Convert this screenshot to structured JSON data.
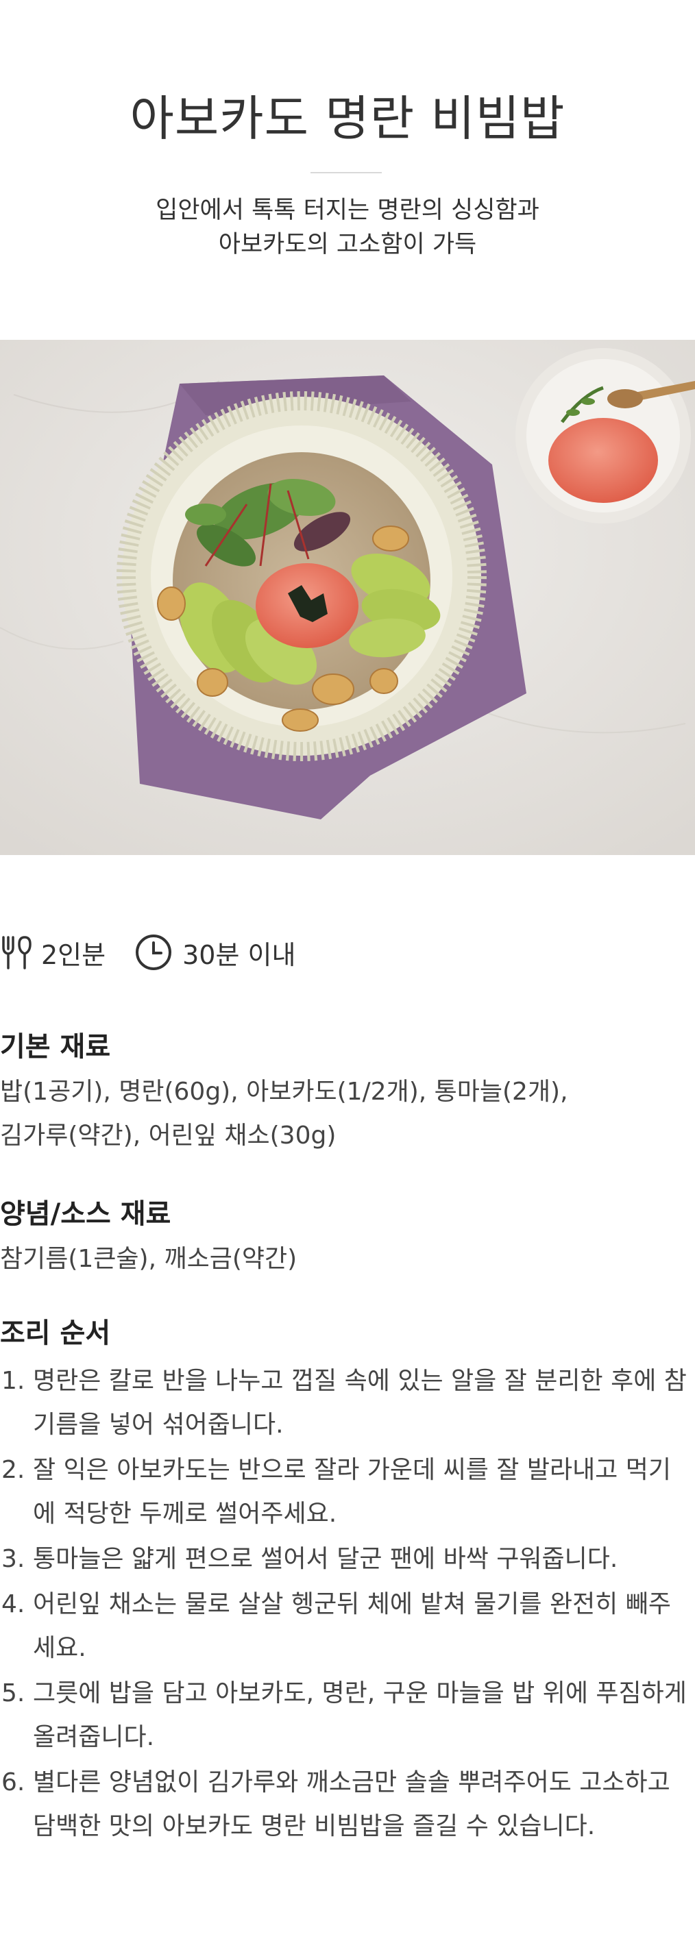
{
  "header": {
    "title": "아보카도 명란 비빔밥",
    "subtitle_line1": "입안에서 톡톡 터지는 명란의 싱싱함과",
    "subtitle_line2": "아보카도의 고소함이 가득"
  },
  "meta": {
    "servings_icon": "utensils-icon",
    "servings": "2인분",
    "time_icon": "clock-icon",
    "time": "30분 이내"
  },
  "basic_ingredients": {
    "title": "기본 재료",
    "line1": "밥(1공기), 명란(60g), 아보카도(1/2개), 통마늘(2개),",
    "line2": "김가루(약간), 어린잎 채소(30g)"
  },
  "sauce_ingredients": {
    "title": "양념/소스 재료",
    "line1": "참기름(1큰술), 깨소금(약간)"
  },
  "steps": {
    "title": "조리 순서",
    "items": [
      {
        "num": "1.",
        "text": "명란은 칼로 반을 나누고 껍질 속에 있는 알을 잘 분리한 후에 참기름을 넣어 섞어줍니다."
      },
      {
        "num": "2.",
        "text": "잘 익은 아보카도는 반으로 잘라 가운데 씨를 잘 발라내고 먹기에 적당한 두께로 썰어주세요."
      },
      {
        "num": "3.",
        "text": "통마늘은 얇게 편으로 썰어서 달군 팬에 바싹 구워줍니다."
      },
      {
        "num": "4.",
        "text": "어린잎 채소는 물로 살살 헹군뒤 체에 밭쳐 물기를 완전히 빼주세요."
      },
      {
        "num": "5.",
        "text": "그릇에 밥을 담고 아보카도, 명란, 구운 마늘을 밥 위에 푸짐하게 올려줍니다."
      },
      {
        "num": "6.",
        "text": "별다른 양념없이 김가루와 깨소금만 솔솔 뿌려주어도 고소하고 담백한 맛의 아보카도 명란 비빔밥을 즐길 수 있습니다."
      }
    ]
  },
  "colors": {
    "marble": "#e4e1dd",
    "napkin": "#8a6a95",
    "avocado": "#b6cf5a",
    "mentaiko": "#e8715c"
  }
}
